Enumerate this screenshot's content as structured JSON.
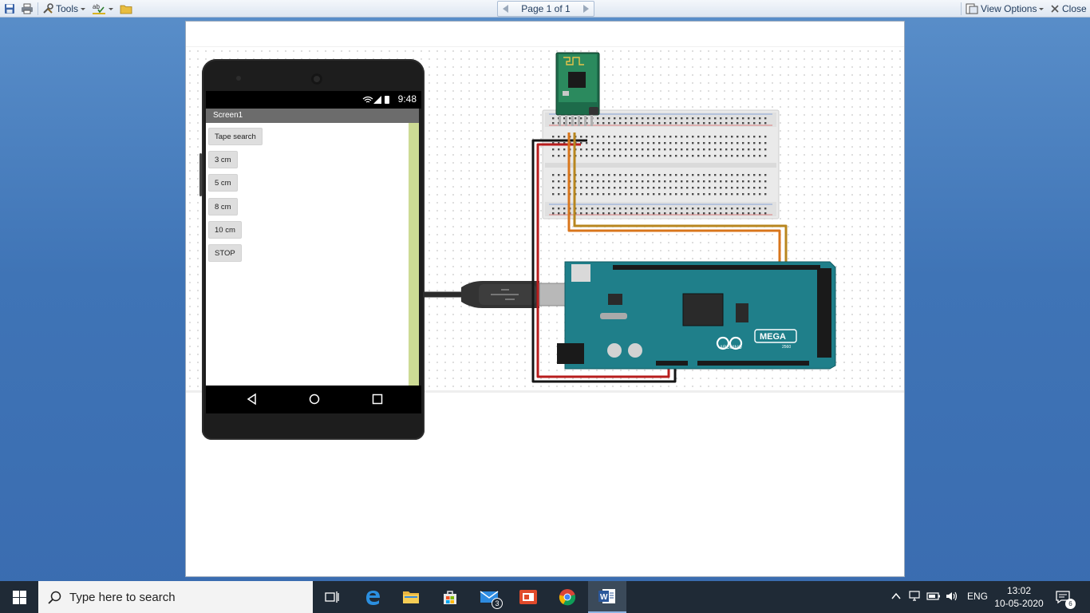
{
  "toolbar": {
    "tools_label": "Tools",
    "page_indicator": "Page 1 of 1",
    "view_options_label": "View Options",
    "close_label": "Close"
  },
  "phone": {
    "status_time": "9:48",
    "screen_title": "Screen1",
    "buttons": [
      "Tape search",
      "3 cm",
      "5 cm",
      "8 cm",
      "10 cm",
      "STOP"
    ]
  },
  "circuit": {
    "board_brand": "ARDUINO",
    "board_model": "MEGA",
    "board_variant": "2560"
  },
  "taskbar": {
    "search_placeholder": "Type here to search",
    "mail_badge": "3",
    "language": "ENG",
    "time": "13:02",
    "date": "10-05-2020",
    "notification_count": "6"
  },
  "colors": {
    "desktop_blue": "#3f74b6",
    "arduino_teal": "#1f7f8a",
    "wire_red": "#b81d1d",
    "wire_black": "#151515",
    "wire_orange": "#d9761c",
    "wire_olive": "#b8861e",
    "app_scroll": "#cddb95"
  }
}
